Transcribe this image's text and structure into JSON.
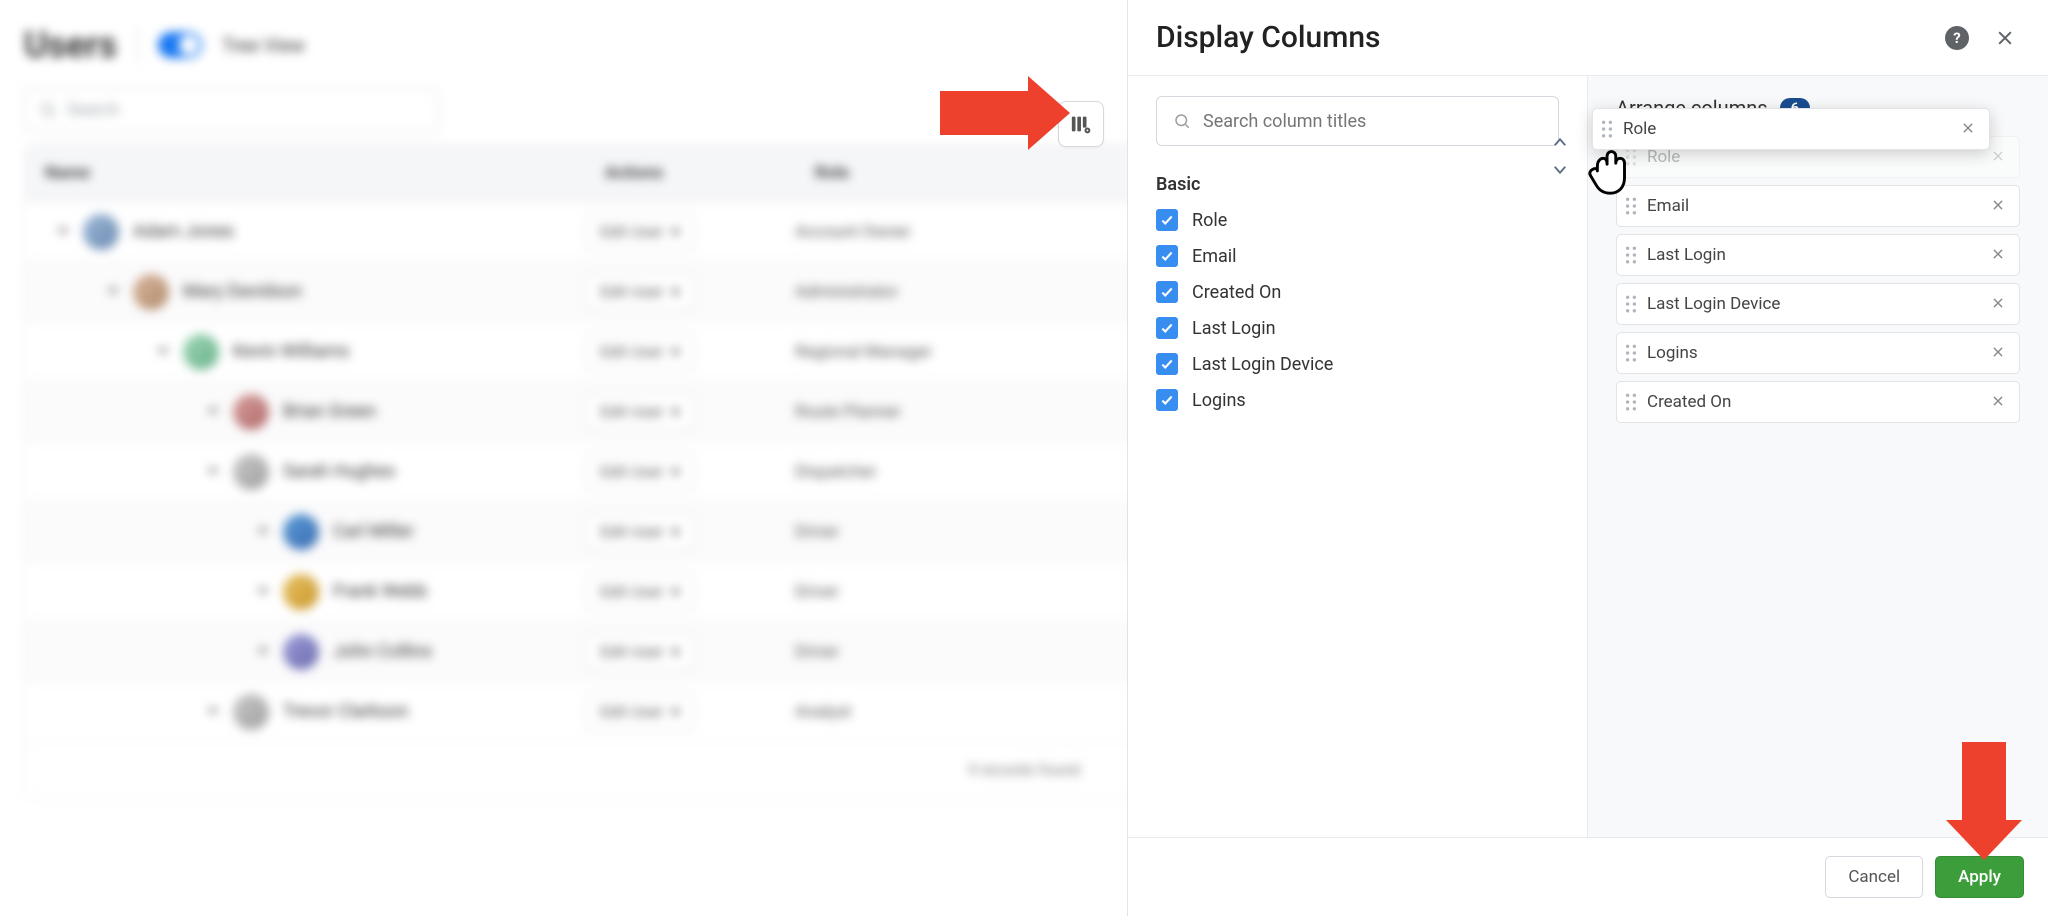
{
  "header": {
    "title": "Users",
    "tree_view_label": "Tree View"
  },
  "bg": {
    "search_placeholder": "Search",
    "columns": {
      "name": "Name",
      "actions": "Actions",
      "role": "Role"
    },
    "edit_label": "Edit User",
    "rows": [
      {
        "indent": 0,
        "name": "Adam Jones",
        "role": "Account Owner",
        "avatar": ""
      },
      {
        "indent": 1,
        "name": "Mary Davidson",
        "role": "Administrator",
        "avatar": "a2"
      },
      {
        "indent": 2,
        "name": "Kevin Williams",
        "role": "Regional Manager",
        "avatar": "a3"
      },
      {
        "indent": 3,
        "name": "Brian Green",
        "role": "Route Planner",
        "avatar": "a4"
      },
      {
        "indent": 3,
        "name": "Sarah Hughes",
        "role": "Dispatcher",
        "avatar": "a5"
      },
      {
        "indent": 4,
        "name": "Carl Miller",
        "role": "Driver",
        "avatar": "a6"
      },
      {
        "indent": 4,
        "name": "Frank Webb",
        "role": "Driver",
        "avatar": "a7"
      },
      {
        "indent": 4,
        "name": "John Collins",
        "role": "Driver",
        "avatar": "a8"
      },
      {
        "indent": 3,
        "name": "Trevor Clarkson",
        "role": "Analyst",
        "avatar": "a5"
      }
    ],
    "footer_text": "9 records found"
  },
  "panel": {
    "title": "Display Columns",
    "search_placeholder": "Search column titles",
    "group_label": "Basic",
    "checks": [
      {
        "label": "Role",
        "checked": true
      },
      {
        "label": "Email",
        "checked": true
      },
      {
        "label": "Created On",
        "checked": true
      },
      {
        "label": "Last Login",
        "checked": true
      },
      {
        "label": "Last Login Device",
        "checked": true
      },
      {
        "label": "Logins",
        "checked": true
      }
    ],
    "arrange_title": "Arrange columns",
    "arrange_count": "6",
    "arrange_items": [
      {
        "label": "Role",
        "ghost": true
      },
      {
        "label": "Email"
      },
      {
        "label": "Last Login"
      },
      {
        "label": "Last Login Device"
      },
      {
        "label": "Logins"
      },
      {
        "label": "Created On"
      }
    ],
    "dragging_label": "Role",
    "cancel": "Cancel",
    "apply": "Apply"
  }
}
